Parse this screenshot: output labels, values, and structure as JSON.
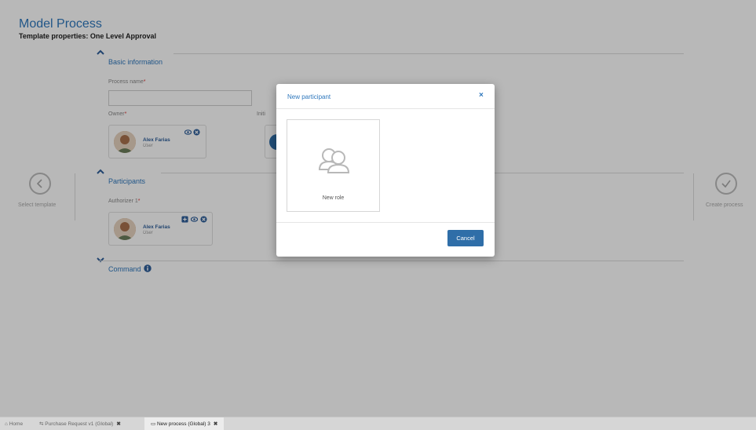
{
  "header": {
    "title": "Model Process",
    "subtitle": "Template properties: One Level Approval"
  },
  "sections": {
    "basic_information": "Basic information",
    "participants": "Participants",
    "command": "Command"
  },
  "fields": {
    "process_name_label": "Process name",
    "owner_label": "Owner",
    "initiator_label_partial": "Initi",
    "authorizer_label": "Authorizer 1",
    "required_mark": "*"
  },
  "owner": {
    "name": "Alex Farias",
    "role": "User"
  },
  "authorizer": {
    "name": "Alex Farias",
    "role": "User"
  },
  "nav": {
    "prev_label": "Select template",
    "next_label": "Create process"
  },
  "modal": {
    "title": "New participant",
    "close_symbol": "×",
    "tile_label": "New role",
    "cancel_label": "Cancel"
  },
  "taskbar": {
    "tabs": [
      {
        "label": "Home",
        "icon": "home-icon",
        "closable": false
      },
      {
        "label": "Purchase Request v1 (Global)",
        "icon": "process-icon",
        "closable": true
      },
      {
        "label": "New process (Global) 3",
        "icon": "window-icon",
        "closable": true,
        "active": true
      }
    ],
    "close_symbol": "✖"
  },
  "colors": {
    "accent": "#2f78bd",
    "button": "#2f6ea8",
    "required": "#dd3333"
  }
}
